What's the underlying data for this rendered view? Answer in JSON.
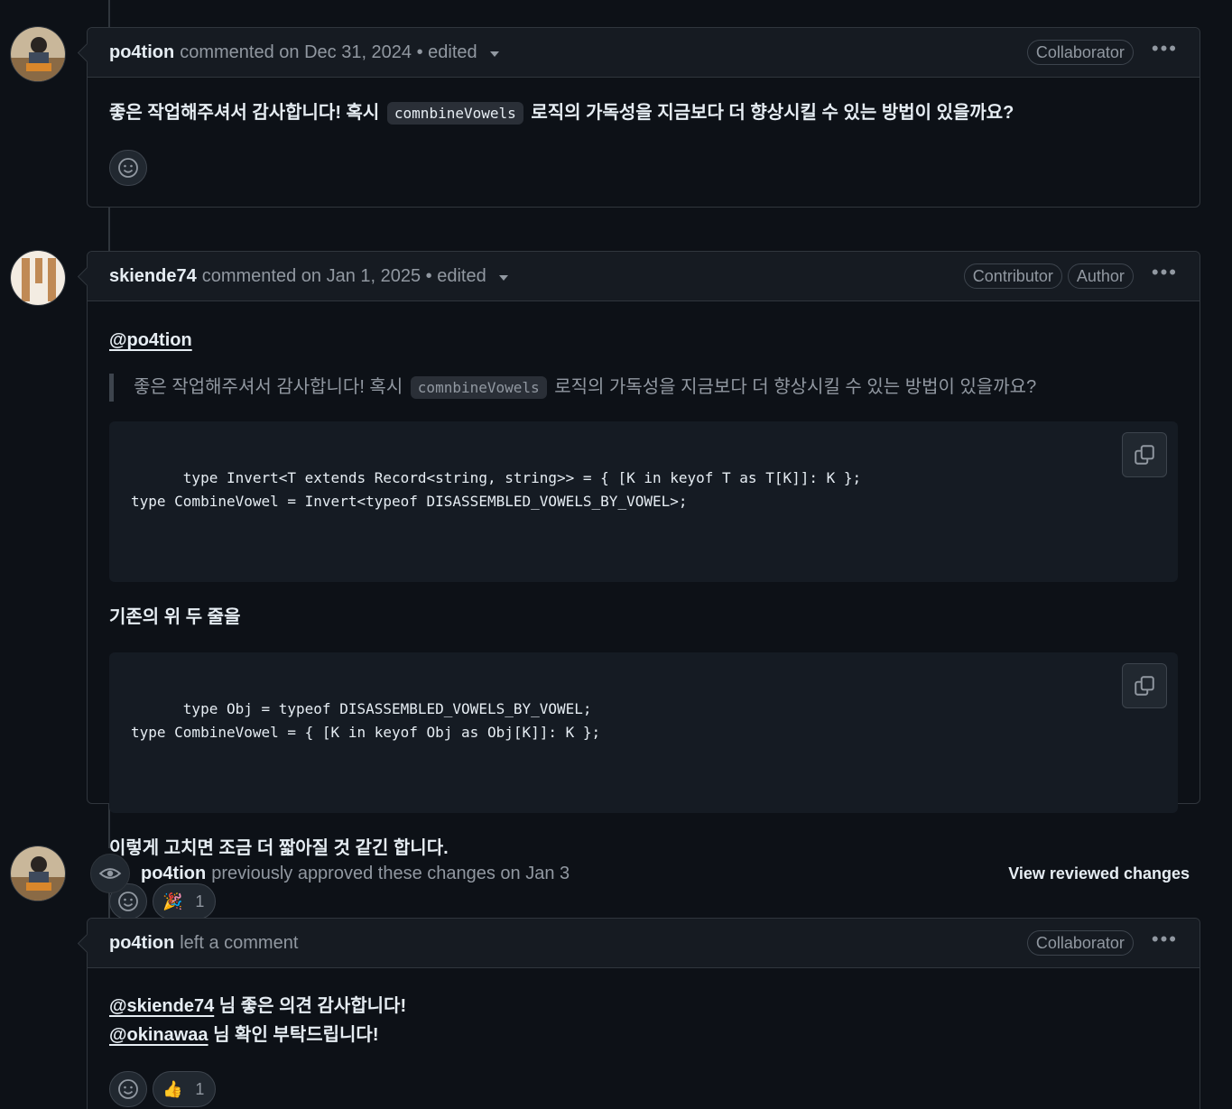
{
  "comments": [
    {
      "author": "po4tion",
      "meta": "commented on Dec 31, 2024 • edited",
      "badges": [
        "Collaborator"
      ],
      "body": {
        "text_before": "좋은 작업해주셔서 감사합니다! 혹시",
        "code": "comnbineVowels",
        "text_after": "로직의 가독성을 지금보다 더 향상시킬 수 있는 방법이 있을까요?"
      }
    },
    {
      "author": "skiende74",
      "meta": "commented on Jan 1, 2025 • edited",
      "badges": [
        "Contributor",
        "Author"
      ],
      "mention": "@po4tion",
      "quote": {
        "text_before": "좋은 작업해주셔서 감사합니다! 혹시",
        "code": "comnbineVowels",
        "text_after": "로직의 가독성을 지금보다 더 향상시킬 수 있는 방법이 있을까요?"
      },
      "code_block_1": "type Invert<T extends Record<string, string>> = { [K in keyof T as T[K]]: K };\ntype CombineVowel = Invert<typeof DISASSEMBLED_VOWELS_BY_VOWEL>;",
      "paragraph_1": "기존의 위 두 줄을",
      "code_block_2": "type Obj = typeof DISASSEMBLED_VOWELS_BY_VOWEL;\ntype CombineVowel = { [K in keyof Obj as Obj[K]]: K };",
      "paragraph_2": "이렇게 고치면 조금 더 짧아질 것 같긴 합니다.",
      "reaction": {
        "emoji": "🎉",
        "count": "1"
      }
    }
  ],
  "review": {
    "author": "po4tion",
    "text": "previously approved these changes on Jan 3",
    "view_changes_label": "View reviewed changes"
  },
  "review_comment": {
    "author": "po4tion",
    "meta": "left a comment",
    "badge": "Collaborator",
    "mention_1": "@skiende74",
    "line_1": " 님 좋은 의견 감사합니다!",
    "mention_2": "@okinawaa",
    "line_2": " 님 확인 부탁드립니다!",
    "reaction": {
      "emoji": "👍",
      "count": "1"
    }
  },
  "kebab_glyph": "•••",
  "colors": {
    "background": "#0d1117",
    "header": "#161b22",
    "border": "#30363d"
  }
}
